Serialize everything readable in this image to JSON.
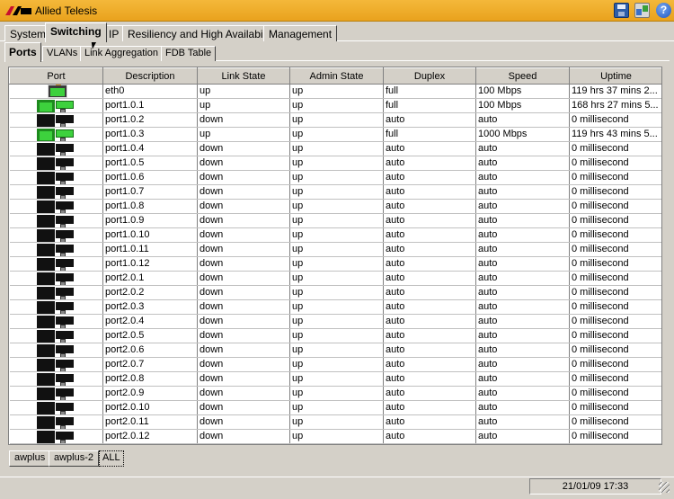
{
  "window": {
    "title": "Allied Telesis",
    "logo_text": "AT"
  },
  "main_tabs": [
    {
      "label": "System"
    },
    {
      "label": "Switching",
      "active": true
    },
    {
      "label": "IP"
    },
    {
      "label": "Resiliency and High Availability"
    },
    {
      "label": "Management"
    }
  ],
  "sub_tabs": [
    {
      "label": "Ports",
      "active": true
    },
    {
      "label": "VLANs"
    },
    {
      "label": "Link Aggregation"
    },
    {
      "label": "FDB Table"
    }
  ],
  "table": {
    "columns": [
      "Port",
      "Description",
      "Link State",
      "Admin State",
      "Duplex",
      "Speed",
      "Uptime"
    ],
    "rows": [
      {
        "port_icon": "single-up",
        "description": "eth0",
        "link_state": "up",
        "admin_state": "up",
        "duplex": "full",
        "speed": "100 Mbps",
        "uptime": "119 hrs 37 mins 2..."
      },
      {
        "port_icon": "up",
        "description": "port1.0.1",
        "link_state": "up",
        "admin_state": "up",
        "duplex": "full",
        "speed": "100 Mbps",
        "uptime": "168 hrs 27 mins 5..."
      },
      {
        "port_icon": "down",
        "description": "port1.0.2",
        "link_state": "down",
        "admin_state": "up",
        "duplex": "auto",
        "speed": "auto",
        "uptime": "0 millisecond"
      },
      {
        "port_icon": "up",
        "description": "port1.0.3",
        "link_state": "up",
        "admin_state": "up",
        "duplex": "full",
        "speed": "1000 Mbps",
        "uptime": "119 hrs 43 mins 5..."
      },
      {
        "port_icon": "down",
        "description": "port1.0.4",
        "link_state": "down",
        "admin_state": "up",
        "duplex": "auto",
        "speed": "auto",
        "uptime": "0 millisecond"
      },
      {
        "port_icon": "down",
        "description": "port1.0.5",
        "link_state": "down",
        "admin_state": "up",
        "duplex": "auto",
        "speed": "auto",
        "uptime": "0 millisecond"
      },
      {
        "port_icon": "down",
        "description": "port1.0.6",
        "link_state": "down",
        "admin_state": "up",
        "duplex": "auto",
        "speed": "auto",
        "uptime": "0 millisecond"
      },
      {
        "port_icon": "down",
        "description": "port1.0.7",
        "link_state": "down",
        "admin_state": "up",
        "duplex": "auto",
        "speed": "auto",
        "uptime": "0 millisecond"
      },
      {
        "port_icon": "down",
        "description": "port1.0.8",
        "link_state": "down",
        "admin_state": "up",
        "duplex": "auto",
        "speed": "auto",
        "uptime": "0 millisecond"
      },
      {
        "port_icon": "down",
        "description": "port1.0.9",
        "link_state": "down",
        "admin_state": "up",
        "duplex": "auto",
        "speed": "auto",
        "uptime": "0 millisecond"
      },
      {
        "port_icon": "down",
        "description": "port1.0.10",
        "link_state": "down",
        "admin_state": "up",
        "duplex": "auto",
        "speed": "auto",
        "uptime": "0 millisecond"
      },
      {
        "port_icon": "down",
        "description": "port1.0.11",
        "link_state": "down",
        "admin_state": "up",
        "duplex": "auto",
        "speed": "auto",
        "uptime": "0 millisecond"
      },
      {
        "port_icon": "down",
        "description": "port1.0.12",
        "link_state": "down",
        "admin_state": "up",
        "duplex": "auto",
        "speed": "auto",
        "uptime": "0 millisecond"
      },
      {
        "port_icon": "down",
        "description": "port2.0.1",
        "link_state": "down",
        "admin_state": "up",
        "duplex": "auto",
        "speed": "auto",
        "uptime": "0 millisecond"
      },
      {
        "port_icon": "down",
        "description": "port2.0.2",
        "link_state": "down",
        "admin_state": "up",
        "duplex": "auto",
        "speed": "auto",
        "uptime": "0 millisecond"
      },
      {
        "port_icon": "down",
        "description": "port2.0.3",
        "link_state": "down",
        "admin_state": "up",
        "duplex": "auto",
        "speed": "auto",
        "uptime": "0 millisecond"
      },
      {
        "port_icon": "down",
        "description": "port2.0.4",
        "link_state": "down",
        "admin_state": "up",
        "duplex": "auto",
        "speed": "auto",
        "uptime": "0 millisecond"
      },
      {
        "port_icon": "down",
        "description": "port2.0.5",
        "link_state": "down",
        "admin_state": "up",
        "duplex": "auto",
        "speed": "auto",
        "uptime": "0 millisecond"
      },
      {
        "port_icon": "down",
        "description": "port2.0.6",
        "link_state": "down",
        "admin_state": "up",
        "duplex": "auto",
        "speed": "auto",
        "uptime": "0 millisecond"
      },
      {
        "port_icon": "down",
        "description": "port2.0.7",
        "link_state": "down",
        "admin_state": "up",
        "duplex": "auto",
        "speed": "auto",
        "uptime": "0 millisecond"
      },
      {
        "port_icon": "down",
        "description": "port2.0.8",
        "link_state": "down",
        "admin_state": "up",
        "duplex": "auto",
        "speed": "auto",
        "uptime": "0 millisecond"
      },
      {
        "port_icon": "down",
        "description": "port2.0.9",
        "link_state": "down",
        "admin_state": "up",
        "duplex": "auto",
        "speed": "auto",
        "uptime": "0 millisecond"
      },
      {
        "port_icon": "down",
        "description": "port2.0.10",
        "link_state": "down",
        "admin_state": "up",
        "duplex": "auto",
        "speed": "auto",
        "uptime": "0 millisecond"
      },
      {
        "port_icon": "down",
        "description": "port2.0.11",
        "link_state": "down",
        "admin_state": "up",
        "duplex": "auto",
        "speed": "auto",
        "uptime": "0 millisecond"
      },
      {
        "port_icon": "down",
        "description": "port2.0.12",
        "link_state": "down",
        "admin_state": "up",
        "duplex": "auto",
        "speed": "auto",
        "uptime": "0 millisecond"
      }
    ]
  },
  "bottom_tabs": [
    {
      "label": "awplus"
    },
    {
      "label": "awplus-2"
    },
    {
      "label": "ALL",
      "active": true
    }
  ],
  "status": {
    "datetime": "21/01/09 17:33"
  },
  "colors": {
    "title_bar": "#f0ad2c",
    "port_up": "#3dd13d",
    "port_down": "#111111"
  }
}
